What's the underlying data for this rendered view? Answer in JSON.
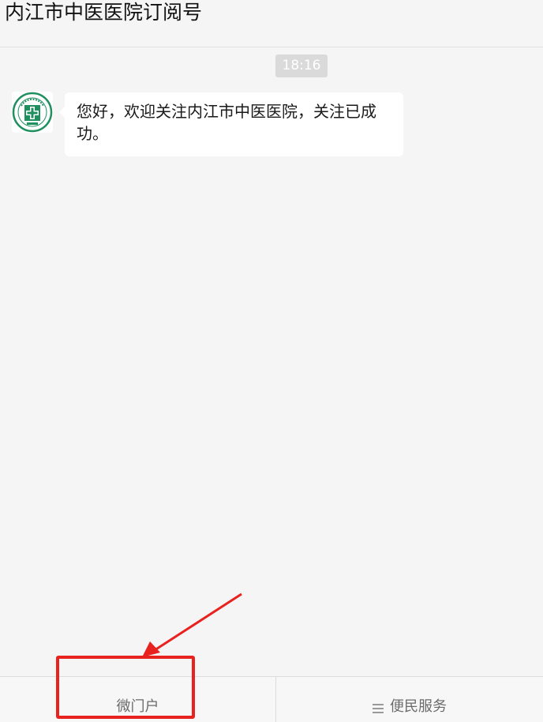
{
  "header": {
    "title": "内江市中医医院订阅号"
  },
  "chat": {
    "timestamp": "18:16",
    "messages": [
      {
        "sender": "hospital-account",
        "avatar_icon": "hospital-logo-icon",
        "text": "您好，欢迎关注内江市中医医院，关注已成功。"
      }
    ]
  },
  "bottom_menu": {
    "items": [
      {
        "label": "微门户",
        "has_submenu": false
      },
      {
        "label": "便民服务",
        "has_submenu": true,
        "icon": "menu-lines-icon"
      }
    ]
  },
  "annotation": {
    "highlight_color": "#e8231f",
    "target": "微门户"
  },
  "colors": {
    "background": "#f5f5f5",
    "bubble": "#ffffff",
    "logo_green": "#1f8f5f",
    "annotation_red": "#e8231f"
  }
}
